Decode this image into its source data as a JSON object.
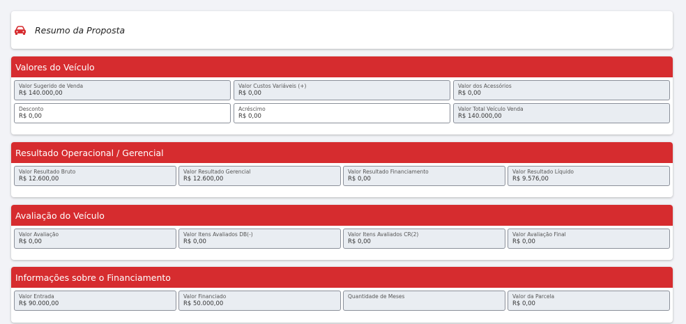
{
  "header": {
    "title": "Resumo da Proposta",
    "icon": "car-icon",
    "icon_color": "#d62c2f"
  },
  "accent_color": "#d62c2f",
  "sections": [
    {
      "title": "Valores do Veículo",
      "fields": [
        {
          "label": "Valor Sugerido de Venda",
          "value": "R$ 140.000,00"
        },
        {
          "label": "Valor Custos Variáveis (+)",
          "value": "R$ 0,00"
        },
        {
          "label": "Valor dos Acessórios",
          "value": "R$ 0,00"
        },
        {
          "label": "Desconto",
          "value": "R$ 0,00"
        },
        {
          "label": "Acréscimo",
          "value": "R$ 0,00"
        },
        {
          "label": "Valor Total Veículo Venda",
          "value": "R$ 140.000,00"
        }
      ]
    },
    {
      "title": "Resultado Operacional / Gerencial",
      "fields": [
        {
          "label": "Valor Resultado Bruto",
          "value": "R$ 12.600,00"
        },
        {
          "label": "Valor Resultado Gerencial",
          "value": "R$ 12.600,00"
        },
        {
          "label": "Valor Resultado Financiamento",
          "value": "R$ 0,00"
        },
        {
          "label": "Valor Resultado Líquido",
          "value": "R$ 9.576,00"
        }
      ]
    },
    {
      "title": "Avaliação do Veículo",
      "fields": [
        {
          "label": "Valor Avaliação",
          "value": "R$ 0,00"
        },
        {
          "label": "Valor Itens Avaliados DB(-)",
          "value": "R$ 0,00"
        },
        {
          "label": "Valor Itens Avaliados CR(2)",
          "value": "R$ 0,00"
        },
        {
          "label": "Valor Avaliação Final",
          "value": "R$ 0,00"
        }
      ]
    },
    {
      "title": "Informações sobre o Financiamento",
      "fields": [
        {
          "label": "Valor Entrada",
          "value": "R$ 90.000,00"
        },
        {
          "label": "Valor Financiado",
          "value": "R$ 50.000,00"
        },
        {
          "label": "Quantidade de Meses",
          "value": ""
        },
        {
          "label": "Valor da Parcela",
          "value": "R$ 0,00"
        }
      ]
    }
  ]
}
